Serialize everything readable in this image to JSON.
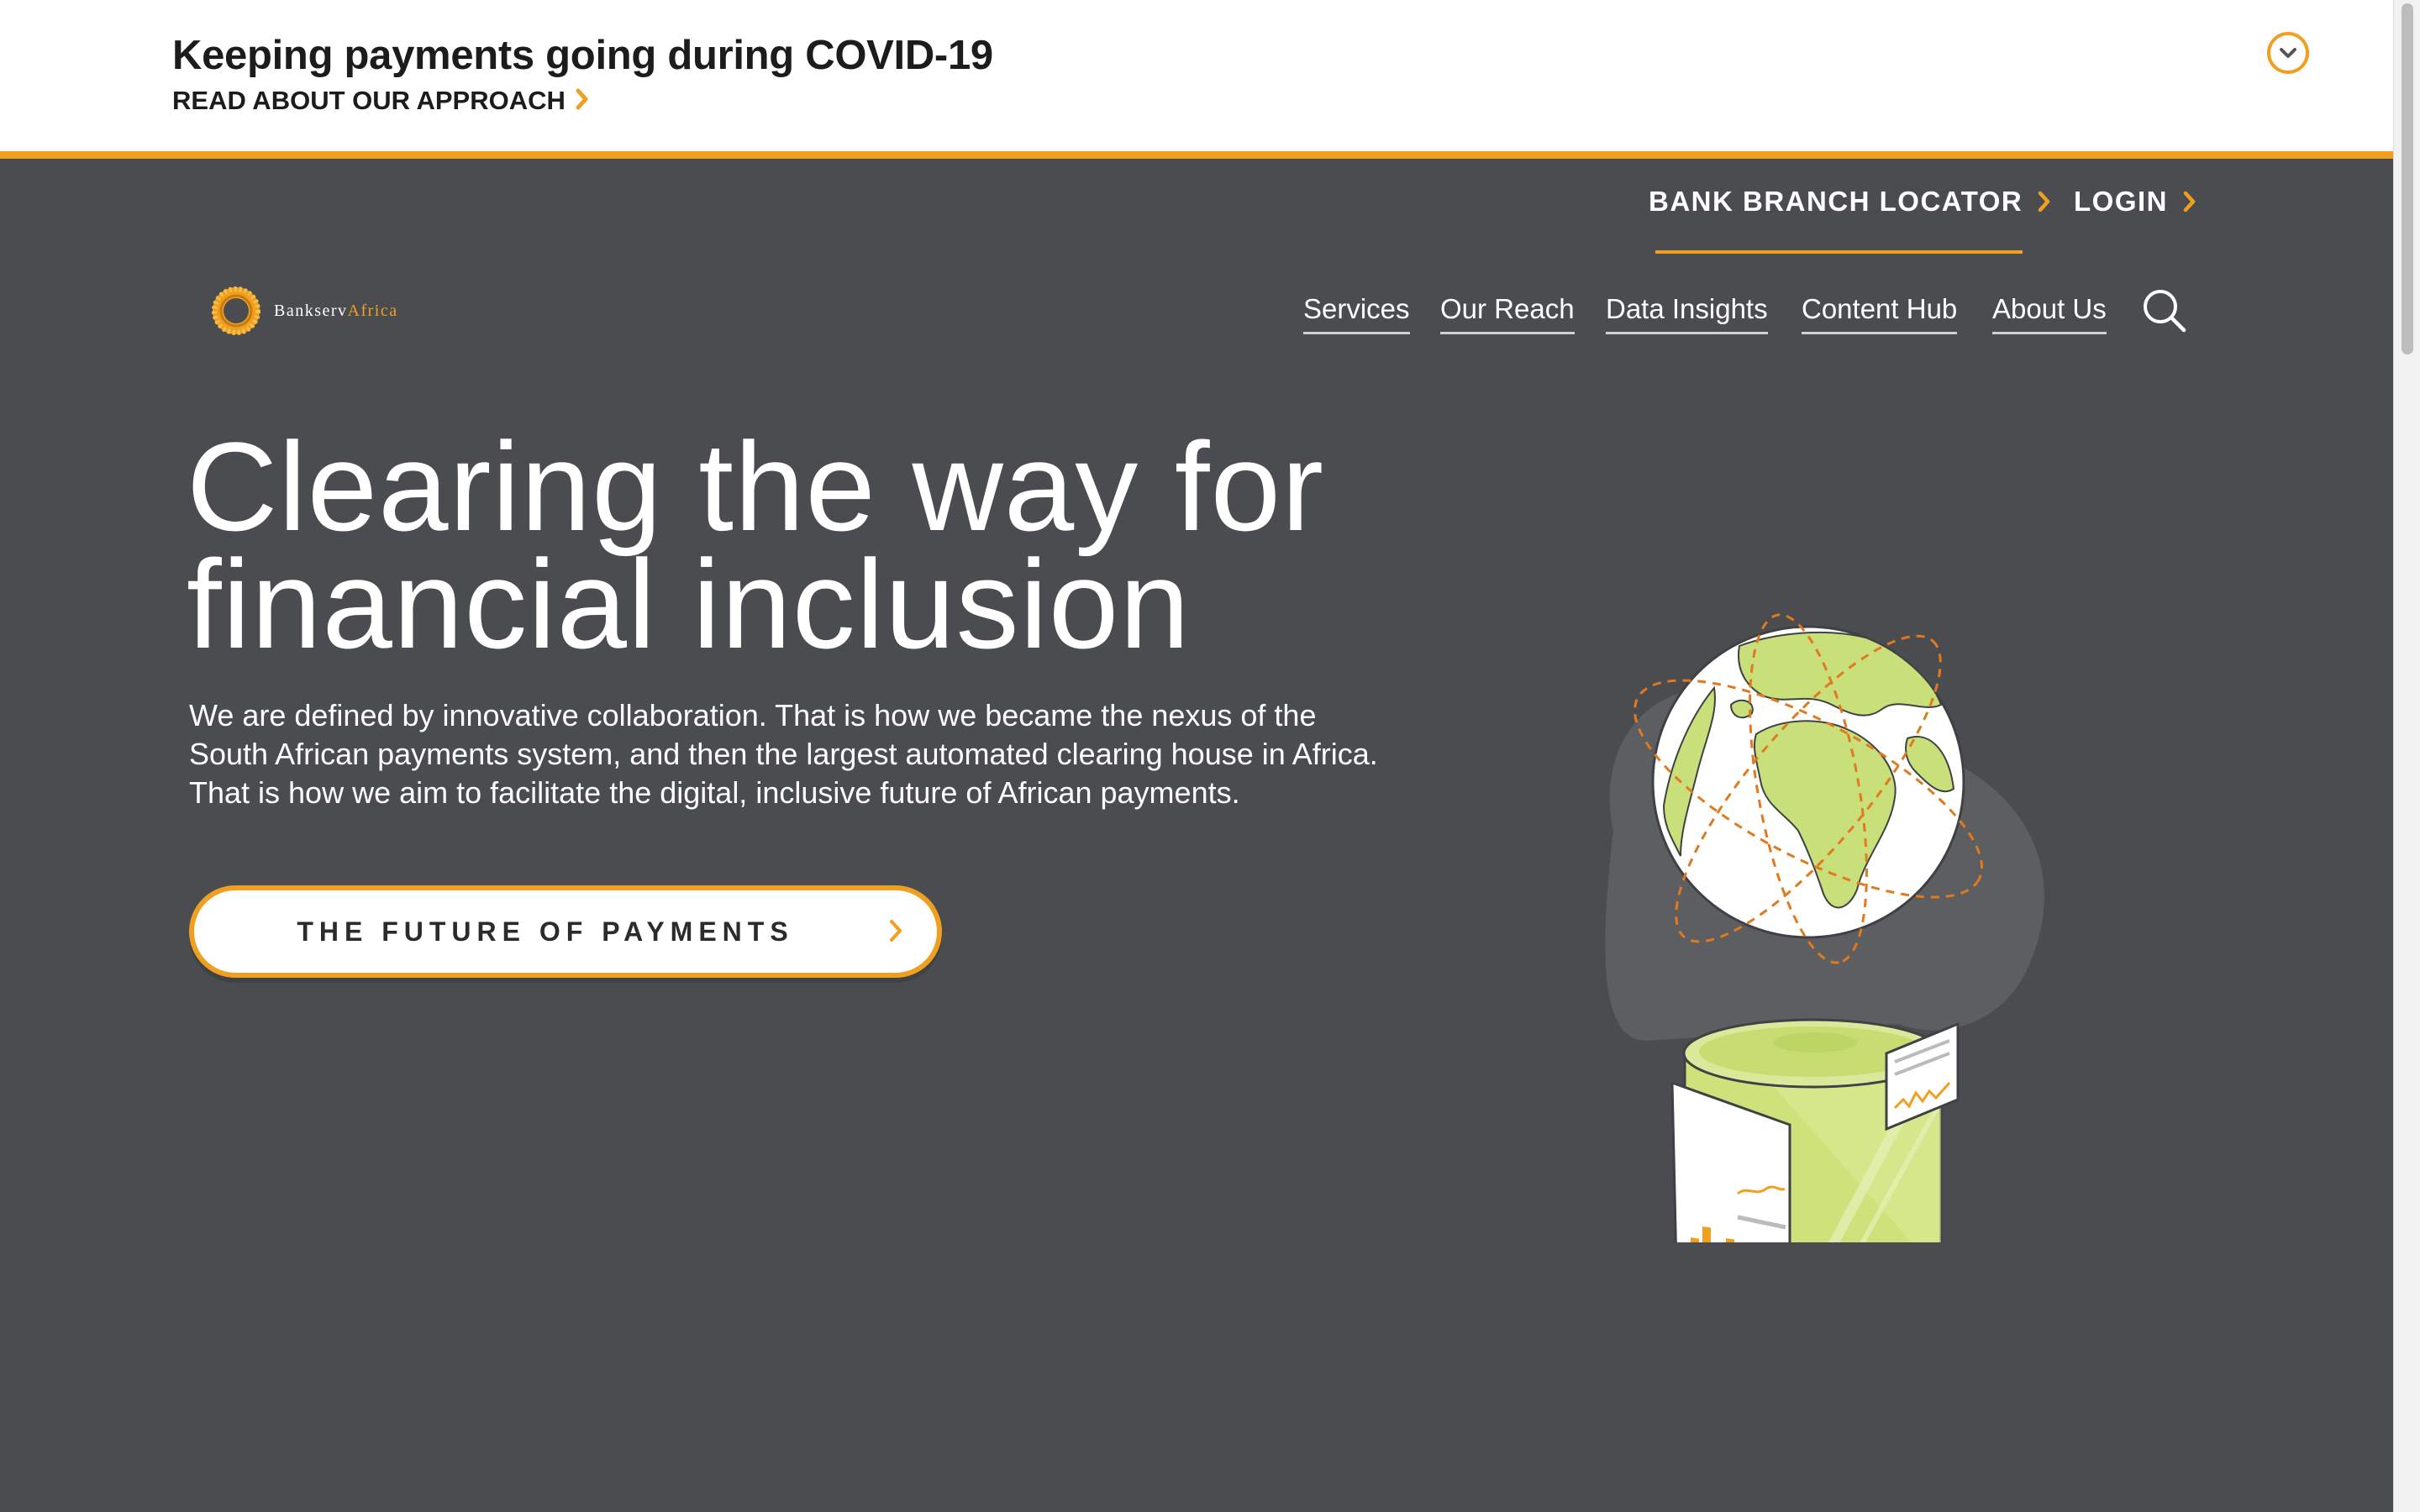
{
  "banner": {
    "title": "Keeping payments going during COVID-19",
    "link_label": "READ ABOUT OUR APPROACH",
    "toggle_icon": "chevron-down-icon"
  },
  "colors": {
    "accent": "#f0a020",
    "hero_background": "#4a4c50",
    "globe_green": "#c9e07a",
    "text_dark": "#1c1c1e"
  },
  "utility_nav": [
    {
      "label": "BANK BRANCH LOCATOR",
      "icon": "chevron-right-icon",
      "active": true
    },
    {
      "label": "LOGIN",
      "icon": "chevron-right-icon",
      "active": false
    }
  ],
  "logo": {
    "name_part1": "Bankserv",
    "name_part2": "Africa"
  },
  "main_nav": [
    {
      "label": "Services"
    },
    {
      "label": "Our Reach"
    },
    {
      "label": "Data Insights"
    },
    {
      "label": "Content Hub"
    },
    {
      "label": "About Us"
    }
  ],
  "search": {
    "icon": "search-icon"
  },
  "hero": {
    "headline_line1": "Clearing the way for",
    "headline_line2": "financial inclusion",
    "body": "We are defined by innovative collaboration. That is how we became the nexus of the South African payments system, and then the largest automated clearing house in Africa. That is how we aim to facilitate the digital, inclusive future of African payments.",
    "cta_label": "THE FUTURE OF PAYMENTS",
    "cta_icon": "chevron-right-icon",
    "illustration": "globe-over-server-illustration"
  }
}
